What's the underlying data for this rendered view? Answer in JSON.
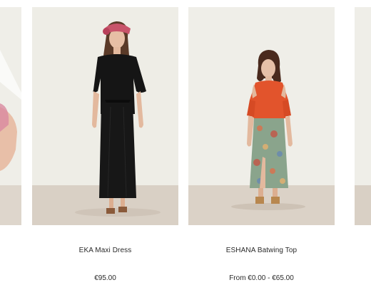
{
  "products": [
    {
      "name": "",
      "price": "",
      "image": "partial-left-product-photo"
    },
    {
      "name": "EKA Maxi Dress",
      "price": "€95.00",
      "image": "black-maxi-dress-photo"
    },
    {
      "name": "ESHANA Batwing Top",
      "price": "From €0.00 - €65.00",
      "image": "orange-batwing-top-photo"
    },
    {
      "name": "",
      "price": "",
      "image": "partial-right-product-photo"
    }
  ],
  "colors": {
    "background": "#ffffff",
    "photo_backdrop": "#eeede6",
    "floor": "#d8cfc4",
    "text": "#2a2a2a"
  }
}
